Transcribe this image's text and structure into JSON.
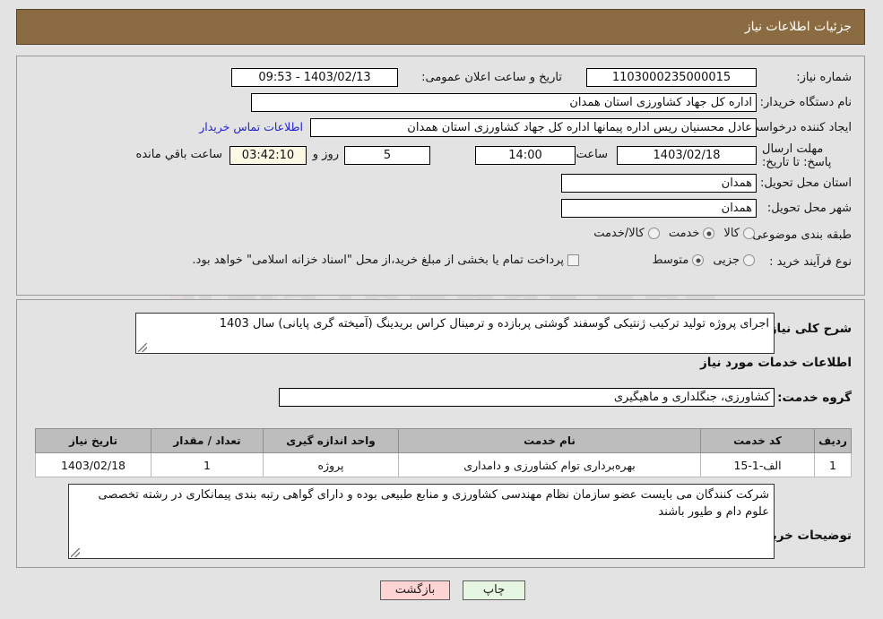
{
  "header": {
    "title": "جزئیات اطلاعات نیاز"
  },
  "top": {
    "need_number_label": "شماره نیاز:",
    "need_number_value": "1103000235000015",
    "announce_label": "تاریخ و ساعت اعلان عمومی:",
    "announce_value": "1403/02/13 - 09:53",
    "buyer_org_label": "نام دستگاه خریدار:",
    "buyer_org_value": "اداره کل جهاد کشاورزی استان همدان",
    "creator_label": "ایجاد کننده درخواست:",
    "creator_value": "عادل محسنیان ریس اداره پیمانها  اداره کل جهاد کشاورزی استان همدان",
    "contact_link": "اطلاعات تماس خریدار",
    "deadline_label": "مهلت ارسال پاسخ: تا تاریخ:",
    "deadline_date": "1403/02/18",
    "time_label": "ساعت",
    "time_value": "14:00",
    "days_value": "5",
    "days_sep": "روز و",
    "countdown_value": "03:42:10",
    "remaining_text": "ساعت باقي مانده",
    "province_label": "استان محل تحویل:",
    "province_value": "همدان",
    "city_label": "شهر محل تحویل:",
    "city_value": "همدان",
    "category_label": "طبقه بندی موضوعی:",
    "category_options": [
      {
        "label": "کالا",
        "selected": false
      },
      {
        "label": "خدمت",
        "selected": true
      },
      {
        "label": "کالا/خدمت",
        "selected": false
      }
    ],
    "process_label": "نوع فرآیند خرید :",
    "process_options": [
      {
        "label": "جزیی",
        "selected": false
      },
      {
        "label": "متوسط",
        "selected": true
      }
    ],
    "treasury_checkbox_checked": false,
    "treasury_text": "پرداخت تمام یا بخشی از مبلغ خرید،از محل \"اسناد خزانه اسلامی\" خواهد بود."
  },
  "lower": {
    "summary_label": "شرح کلی نیاز:",
    "summary_value": "اجرای پروژه تولید ترکیب ژنتیکی گوسفند گوشتی پربازده و ترمینال کراس بریدینگ (آمیخته گری پایانی) سال 1403",
    "services_heading": "اطلاعات خدمات مورد نیاز",
    "service_group_label": "گروه خدمت:",
    "service_group_value": "کشاورزی، جنگلداری و ماهیگیری",
    "table": {
      "headers": [
        "ردیف",
        "کد خدمت",
        "نام خدمت",
        "واحد اندازه گیری",
        "تعداد / مقدار",
        "تاریخ نیاز"
      ],
      "rows": [
        [
          "1",
          "الف-1-15",
          "بهره‌برداری توام کشاورزی و دامداری",
          "پروژه",
          "1",
          "1403/02/18"
        ]
      ]
    },
    "notes_label": "توضیحات خریدار:",
    "notes_value": "شرکت کنندگان می بایست  عضو سازمان نظام مهندسی کشاورزی و منابع طبیعی بوده  و دارای گواهی  رتبه بندی پیمانکاری در رشته تخصصی علوم دام و طیور باشند"
  },
  "footer": {
    "print_label": "چاپ",
    "back_label": "بازگشت"
  },
  "watermark": {
    "text": "AriaTender.net"
  },
  "colors": {
    "header_bg": "#8a6b42",
    "link": "#2222cc",
    "back_btn": "#ffd4d4",
    "print_btn": "#e7f6e2",
    "countdown_bg": "#fbf8e3"
  }
}
